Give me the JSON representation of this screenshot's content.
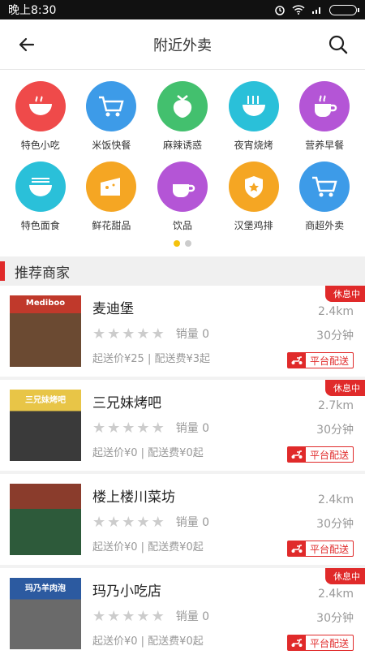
{
  "status": {
    "time": "晚上8:30"
  },
  "header": {
    "title": "附近外卖"
  },
  "categories": [
    {
      "label": "特色小吃",
      "color": "#ef4a4a"
    },
    {
      "label": "米饭快餐",
      "color": "#3d9be8"
    },
    {
      "label": "麻辣诱惑",
      "color": "#43c06e"
    },
    {
      "label": "夜宵烧烤",
      "color": "#2ac0d9"
    },
    {
      "label": "营养早餐",
      "color": "#b455d6"
    },
    {
      "label": "特色面食",
      "color": "#2ac0d9"
    },
    {
      "label": "鲜花甜品",
      "color": "#f5a623"
    },
    {
      "label": "饮品",
      "color": "#b455d6"
    },
    {
      "label": "汉堡鸡排",
      "color": "#f5a623"
    },
    {
      "label": "商超外卖",
      "color": "#3d9be8"
    }
  ],
  "section": {
    "title": "推荐商家"
  },
  "shops": [
    {
      "name": "麦迪堡",
      "sales": "销量 0",
      "fees": "起送价¥25 | 配送费¥3起",
      "distance": "2.4km",
      "time": "30分钟",
      "closed": "休息中",
      "platform": "平台配送",
      "sign": "Mediboo"
    },
    {
      "name": "三兄妹烤吧",
      "sales": "销量 0",
      "fees": "起送价¥0 | 配送费¥0起",
      "distance": "2.7km",
      "time": "30分钟",
      "closed": "休息中",
      "platform": "平台配送",
      "sign": "三兄妹烤吧"
    },
    {
      "name": "楼上楼川菜坊",
      "sales": "销量 0",
      "fees": "起送价¥0 | 配送费¥0起",
      "distance": "2.4km",
      "time": "30分钟",
      "closed": "",
      "platform": "平台配送",
      "sign": ""
    },
    {
      "name": "玛乃小吃店",
      "sales": "销量 0",
      "fees": "起送价¥0 | 配送费¥0起",
      "distance": "2.4km",
      "time": "30分钟",
      "closed": "休息中",
      "platform": "平台配送",
      "sign": "玛乃羊肉泡"
    }
  ]
}
